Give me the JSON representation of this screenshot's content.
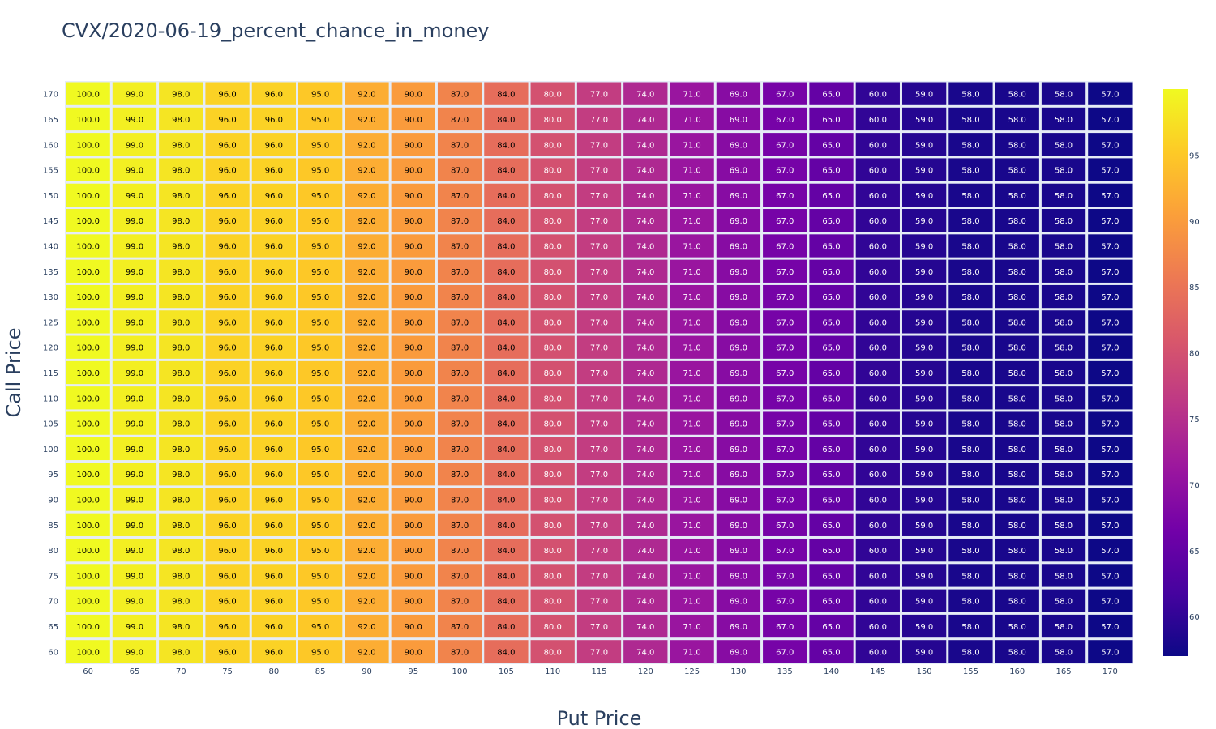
{
  "title": "CVX/2020-06-19_percent_chance_in_money",
  "chart_data": {
    "type": "heatmap",
    "title": "CVX/2020-06-19_percent_chance_in_money",
    "xlabel": "Put Price",
    "ylabel": "Call Price",
    "x": [
      60,
      65,
      70,
      75,
      80,
      85,
      90,
      95,
      100,
      105,
      110,
      115,
      120,
      125,
      130,
      135,
      140,
      145,
      150,
      155,
      160,
      165,
      170
    ],
    "y": [
      60,
      65,
      70,
      75,
      80,
      85,
      90,
      95,
      100,
      105,
      110,
      115,
      120,
      125,
      130,
      135,
      140,
      145,
      150,
      155,
      160,
      165,
      170
    ],
    "row_values": [
      100.0,
      99.0,
      98.0,
      96.0,
      96.0,
      95.0,
      92.0,
      90.0,
      87.0,
      84.0,
      80.0,
      77.0,
      74.0,
      71.0,
      69.0,
      67.0,
      65.0,
      60.0,
      59.0,
      58.0,
      58.0,
      58.0,
      57.0
    ],
    "value_note": "every row has the same values across Put Price",
    "colorscale": "Plasma",
    "zmin": 57,
    "zmax": 100,
    "colorbar_ticks": [
      60,
      65,
      70,
      75,
      80,
      85,
      90,
      95
    ],
    "colors": [
      "#0d0887",
      "#46039f",
      "#7201a8",
      "#9c179e",
      "#bd3786",
      "#d8576b",
      "#ed7953",
      "#fb9f3a",
      "#fdca26",
      "#f0f921"
    ],
    "grid_color": "#e5ecf6"
  }
}
